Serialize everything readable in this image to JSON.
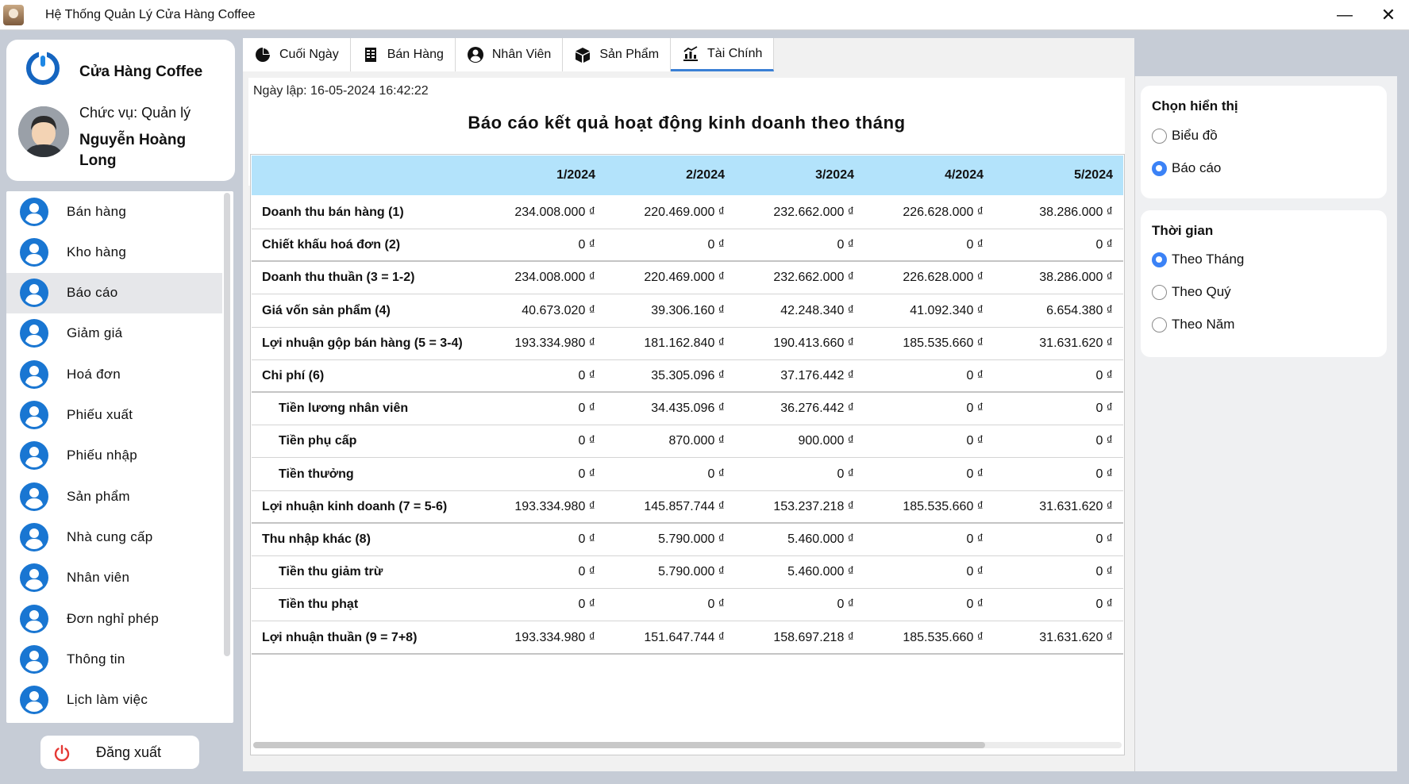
{
  "window": {
    "title": "Hệ Thống Quản Lý Cửa Hàng Coffee",
    "minimize": "—",
    "close": "✕"
  },
  "profile": {
    "store_name": "Cửa Hàng Coffee",
    "role": "Chức vụ: Quản lý",
    "user_name": "Nguyễn Hoàng Long"
  },
  "menu": [
    {
      "label": "Bán hàng",
      "active": false
    },
    {
      "label": "Kho hàng",
      "active": false
    },
    {
      "label": "Báo cáo",
      "active": true
    },
    {
      "label": "Giảm giá",
      "active": false
    },
    {
      "label": "Hoá đơn",
      "active": false
    },
    {
      "label": "Phiếu xuất",
      "active": false
    },
    {
      "label": "Phiếu nhập",
      "active": false
    },
    {
      "label": "Sản phẩm",
      "active": false
    },
    {
      "label": "Nhà cung cấp",
      "active": false
    },
    {
      "label": "Nhân viên",
      "active": false
    },
    {
      "label": "Đơn nghỉ phép",
      "active": false
    },
    {
      "label": "Thông tin",
      "active": false
    },
    {
      "label": "Lịch làm việc",
      "active": false
    }
  ],
  "logout_label": "Đăng xuất",
  "tabs": [
    {
      "label": "Cuối Ngày",
      "icon": "pie-chart-icon",
      "active": false
    },
    {
      "label": "Bán Hàng",
      "icon": "receipt-icon",
      "active": false
    },
    {
      "label": "Nhân Viên",
      "icon": "user-circle-icon",
      "active": false
    },
    {
      "label": "Sản Phẩm",
      "icon": "box-icon",
      "active": false
    },
    {
      "label": "Tài Chính",
      "icon": "finance-icon",
      "active": true
    }
  ],
  "report": {
    "date": "Ngày lập: 16-05-2024 16:42:22",
    "title": "Báo cáo kết quả hoạt động kinh doanh theo tháng",
    "columns": [
      "1/2024",
      "2/2024",
      "3/2024",
      "4/2024",
      "5/2024"
    ],
    "rows": [
      {
        "label": "Doanh thu bán hàng (1)",
        "indent": false,
        "major": false,
        "values": [
          "234.008.000 ₫",
          "220.469.000 ₫",
          "232.662.000 ₫",
          "226.628.000 ₫",
          "38.286.000 ₫"
        ]
      },
      {
        "label": "Chiết khấu hoá đơn (2)",
        "indent": false,
        "major": true,
        "values": [
          "0 ₫",
          "0 ₫",
          "0 ₫",
          "0 ₫",
          "0 ₫"
        ]
      },
      {
        "label": "Doanh thu thuần (3 = 1-2)",
        "indent": false,
        "major": false,
        "values": [
          "234.008.000 ₫",
          "220.469.000 ₫",
          "232.662.000 ₫",
          "226.628.000 ₫",
          "38.286.000 ₫"
        ]
      },
      {
        "label": "Giá vốn sản phẩm (4)",
        "indent": false,
        "major": false,
        "values": [
          "40.673.020 ₫",
          "39.306.160 ₫",
          "42.248.340 ₫",
          "41.092.340 ₫",
          "6.654.380 ₫"
        ]
      },
      {
        "label": "Lợi nhuận gộp bán hàng (5 = 3-4)",
        "indent": false,
        "major": false,
        "values": [
          "193.334.980 ₫",
          "181.162.840 ₫",
          "190.413.660 ₫",
          "185.535.660 ₫",
          "31.631.620 ₫"
        ]
      },
      {
        "label": "Chi phí (6)",
        "indent": false,
        "major": true,
        "values": [
          "0 ₫",
          "35.305.096 ₫",
          "37.176.442 ₫",
          "0 ₫",
          "0 ₫"
        ]
      },
      {
        "label": "Tiền lương nhân viên",
        "indent": true,
        "major": false,
        "values": [
          "0 ₫",
          "34.435.096 ₫",
          "36.276.442 ₫",
          "0 ₫",
          "0 ₫"
        ]
      },
      {
        "label": "Tiền phụ cấp",
        "indent": true,
        "major": false,
        "values": [
          "0 ₫",
          "870.000 ₫",
          "900.000 ₫",
          "0 ₫",
          "0 ₫"
        ]
      },
      {
        "label": "Tiền thưởng",
        "indent": true,
        "major": false,
        "values": [
          "0 ₫",
          "0 ₫",
          "0 ₫",
          "0 ₫",
          "0 ₫"
        ]
      },
      {
        "label": "Lợi nhuận kinh doanh (7 = 5-6)",
        "indent": false,
        "major": true,
        "values": [
          "193.334.980 ₫",
          "145.857.744 ₫",
          "153.237.218 ₫",
          "185.535.660 ₫",
          "31.631.620 ₫"
        ]
      },
      {
        "label": "Thu nhập khác (8)",
        "indent": false,
        "major": false,
        "values": [
          "0 ₫",
          "5.790.000 ₫",
          "5.460.000 ₫",
          "0 ₫",
          "0 ₫"
        ]
      },
      {
        "label": "Tiền thu giảm trừ",
        "indent": true,
        "major": false,
        "values": [
          "0 ₫",
          "5.790.000 ₫",
          "5.460.000 ₫",
          "0 ₫",
          "0 ₫"
        ]
      },
      {
        "label": "Tiền thu phạt",
        "indent": true,
        "major": false,
        "values": [
          "0 ₫",
          "0 ₫",
          "0 ₫",
          "0 ₫",
          "0 ₫"
        ]
      },
      {
        "label": "Lợi nhuận thuần (9 = 7+8)",
        "indent": false,
        "major": true,
        "values": [
          "193.334.980 ₫",
          "151.647.744 ₫",
          "158.697.218 ₫",
          "185.535.660 ₫",
          "31.631.620 ₫"
        ]
      }
    ]
  },
  "display_options": {
    "title": "Chọn hiển thị",
    "options": [
      {
        "label": "Biểu đồ",
        "selected": false
      },
      {
        "label": "Báo cáo",
        "selected": true
      }
    ]
  },
  "time_options": {
    "title": "Thời gian",
    "options": [
      {
        "label": "Theo Tháng",
        "selected": true
      },
      {
        "label": "Theo Quý",
        "selected": false
      },
      {
        "label": "Theo Năm",
        "selected": false
      }
    ]
  },
  "colors": {
    "accent": "#3b82f6",
    "menu_icon": "#1976d2",
    "header_bg": "#b3e3fb",
    "logout_icon": "#e53935"
  }
}
